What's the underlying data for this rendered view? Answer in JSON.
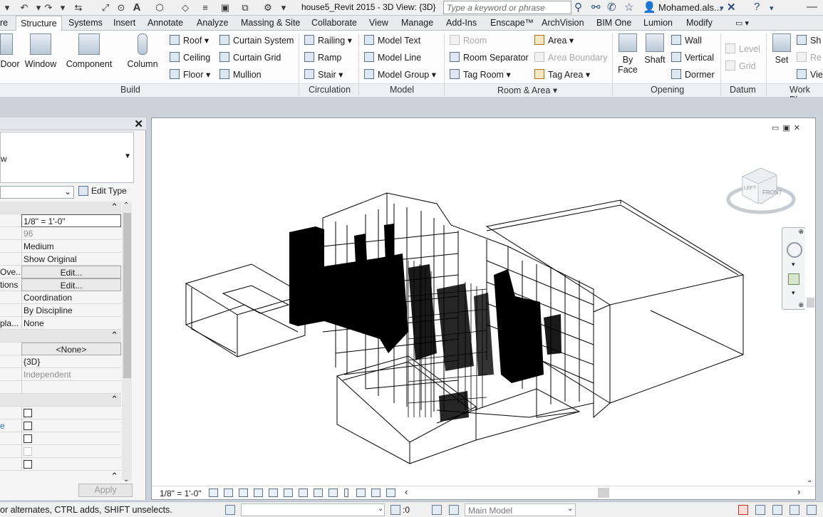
{
  "title_bar": {
    "document_title": "house5_Revit 2015 - 3D View: {3D}",
    "search_placeholder": "Type a keyword or phrase",
    "user": "Mohamed.als...",
    "text_glyph": "A"
  },
  "tabs": [
    {
      "label": "re"
    },
    {
      "label": "Structure"
    },
    {
      "label": "Systems"
    },
    {
      "label": "Insert"
    },
    {
      "label": "Annotate"
    },
    {
      "label": "Analyze"
    },
    {
      "label": "Massing & Site"
    },
    {
      "label": "Collaborate"
    },
    {
      "label": "View"
    },
    {
      "label": "Manage"
    },
    {
      "label": "Add-Ins"
    },
    {
      "label": "Enscape™"
    },
    {
      "label": "ArchVision"
    },
    {
      "label": "BIM One"
    },
    {
      "label": "Lumion"
    },
    {
      "label": "Modify"
    }
  ],
  "ribbon": {
    "build": {
      "label": "Build",
      "door": "Door",
      "window": "Window",
      "component": "Component",
      "column": "Column",
      "roof": "Roof",
      "ceiling": "Ceiling",
      "floor": "Floor",
      "curtain_system": "Curtain System",
      "curtain_grid": "Curtain Grid",
      "mullion": "Mullion"
    },
    "circulation": {
      "label": "Circulation",
      "railing": "Railing",
      "ramp": "Ramp",
      "stair": "Stair"
    },
    "model": {
      "label": "Model",
      "model_text": "Model Text",
      "model_line": "Model Line",
      "model_group": "Model Group"
    },
    "room_area": {
      "label": "Room & Area",
      "room": "Room",
      "room_separator": "Room Separator",
      "tag_room": "Tag Room",
      "area": "Area",
      "area_boundary": "Area Boundary",
      "tag_area": "Tag Area"
    },
    "opening": {
      "label": "Opening",
      "by_face": "By\nFace",
      "shaft": "Shaft",
      "wall": "Wall",
      "vertical": "Vertical",
      "dormer": "Dormer"
    },
    "datum": {
      "label": "Datum",
      "level": "Level",
      "grid": "Grid"
    },
    "work_plane": {
      "label": "Work Pla",
      "set": "Set",
      "show": "Sh",
      "ref": "Re",
      "viewer": "Vie"
    }
  },
  "properties": {
    "type_text": "w",
    "edit_type": "Edit Type",
    "rows": [
      {
        "name": "",
        "value": "1/8\" = 1'-0\"",
        "style": "boxed"
      },
      {
        "name": "",
        "value": "96",
        "style": "grey"
      },
      {
        "name": "",
        "value": "Medium",
        "style": ""
      },
      {
        "name": "",
        "value": "Show Original",
        "style": ""
      },
      {
        "name": "Ove...",
        "value": "Edit...",
        "style": "btn"
      },
      {
        "name": "tions",
        "value": "Edit...",
        "style": "btn"
      },
      {
        "name": "",
        "value": "Coordination",
        "style": ""
      },
      {
        "name": "",
        "value": "By Discipline",
        "style": ""
      },
      {
        "name": "pla...",
        "value": "None",
        "style": ""
      }
    ],
    "rows2": [
      {
        "name": "",
        "value": "<None>",
        "style": "btn"
      },
      {
        "name": "",
        "value": "{3D}",
        "style": ""
      },
      {
        "name": "",
        "value": "Independent",
        "style": "grey"
      }
    ],
    "apply": "Apply"
  },
  "view": {
    "scale": "1/8\" = 1'-0\"",
    "viewcube_face": "FRONT",
    "viewcube_side": "LEFT"
  },
  "status": {
    "text": "or alternates, CTRL adds, SHIFT unselects.",
    "zero": ":0",
    "model": "Main Model"
  }
}
